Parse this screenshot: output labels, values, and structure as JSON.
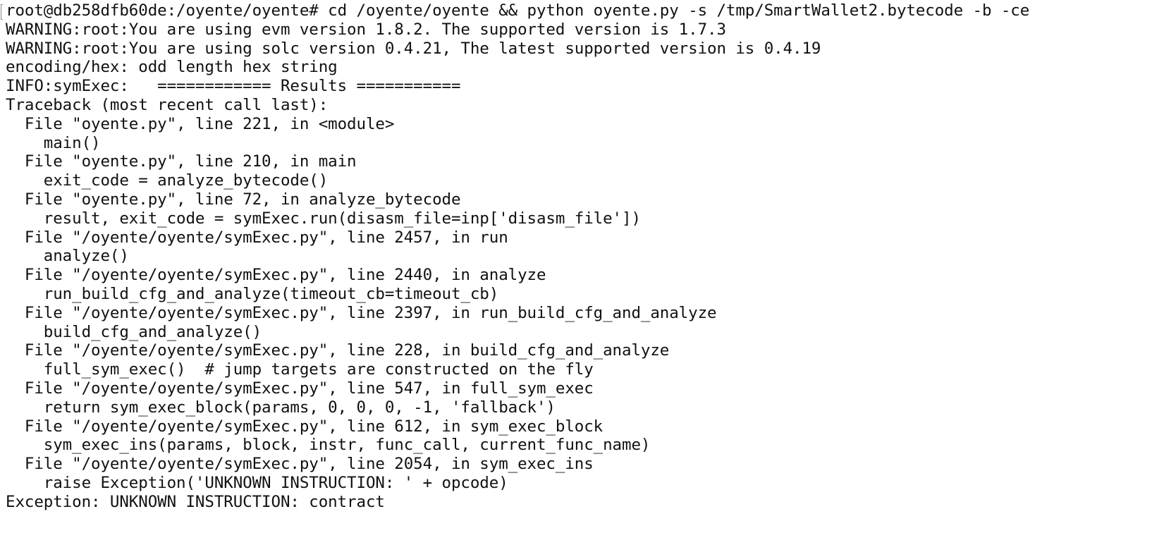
{
  "terminal": {
    "lines": [
      "root@db258dfb60de:/oyente/oyente# cd /oyente/oyente && python oyente.py -s /tmp/SmartWallet2.bytecode -b -ce",
      "WARNING:root:You are using evm version 1.8.2. The supported version is 1.7.3",
      "WARNING:root:You are using solc version 0.4.21, The latest supported version is 0.4.19",
      "encoding/hex: odd length hex string",
      "INFO:symExec:   ============ Results ===========",
      "Traceback (most recent call last):",
      "  File \"oyente.py\", line 221, in <module>",
      "    main()",
      "  File \"oyente.py\", line 210, in main",
      "    exit_code = analyze_bytecode()",
      "  File \"oyente.py\", line 72, in analyze_bytecode",
      "    result, exit_code = symExec.run(disasm_file=inp['disasm_file'])",
      "  File \"/oyente/oyente/symExec.py\", line 2457, in run",
      "    analyze()",
      "  File \"/oyente/oyente/symExec.py\", line 2440, in analyze",
      "    run_build_cfg_and_analyze(timeout_cb=timeout_cb)",
      "  File \"/oyente/oyente/symExec.py\", line 2397, in run_build_cfg_and_analyze",
      "    build_cfg_and_analyze()",
      "  File \"/oyente/oyente/symExec.py\", line 228, in build_cfg_and_analyze",
      "    full_sym_exec()  # jump targets are constructed on the fly",
      "  File \"/oyente/oyente/symExec.py\", line 547, in full_sym_exec",
      "    return sym_exec_block(params, 0, 0, 0, -1, 'fallback')",
      "  File \"/oyente/oyente/symExec.py\", line 612, in sym_exec_block",
      "    sym_exec_ins(params, block, instr, func_call, current_func_name)",
      "  File \"/oyente/oyente/symExec.py\", line 2054, in sym_exec_ins",
      "    raise Exception('UNKNOWN INSTRUCTION: ' + opcode)",
      "Exception: UNKNOWN INSTRUCTION: contract"
    ]
  }
}
